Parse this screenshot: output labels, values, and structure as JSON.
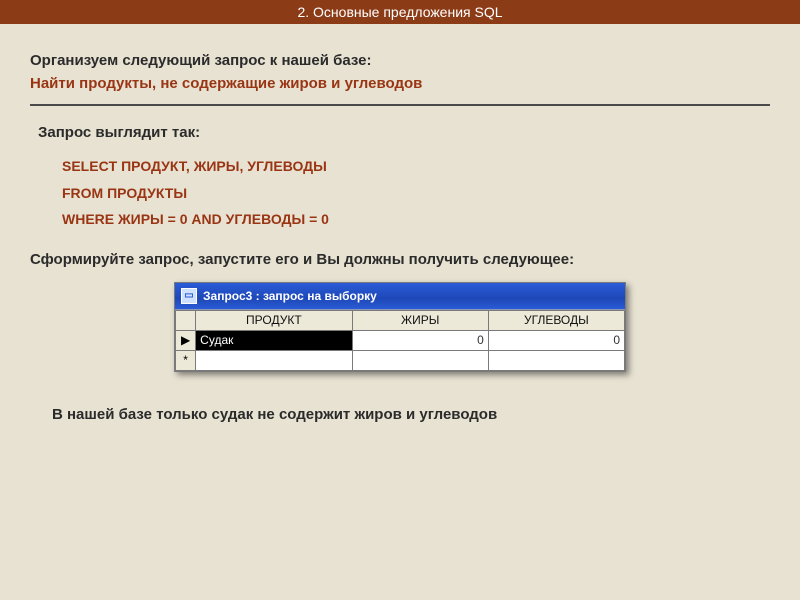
{
  "slide": {
    "title": "2. Основные предложения SQL"
  },
  "text": {
    "intro_black": "Организуем следующий запрос к нашей базе:",
    "intro_red": "Найти продукты, не содержащие жиров и углеводов",
    "query_label": "Запрос выглядит так:",
    "sql_line1": "SELECT ПРОДУКТ, ЖИРЫ, УГЛЕВОДЫ",
    "sql_line2": "FROM ПРОДУКТЫ",
    "sql_line3": "WHERE ЖИРЫ = 0 AND УГЛЕВОДЫ = 0",
    "run_instruction": "Сформируйте запрос, запустите его и Вы должны получить следующее:",
    "conclusion": "В нашей базе только судак не содержит жиров и углеводов"
  },
  "window": {
    "title": "Запрос3 : запрос на выборку",
    "columns": [
      "ПРОДУКТ",
      "ЖИРЫ",
      "УГЛЕВОДЫ"
    ],
    "rows": [
      {
        "selector": "▶",
        "product": "Судак",
        "fat": "0",
        "carb": "0",
        "selected": true
      },
      {
        "selector": "*",
        "product": "",
        "fat": "",
        "carb": "",
        "selected": false
      }
    ]
  }
}
